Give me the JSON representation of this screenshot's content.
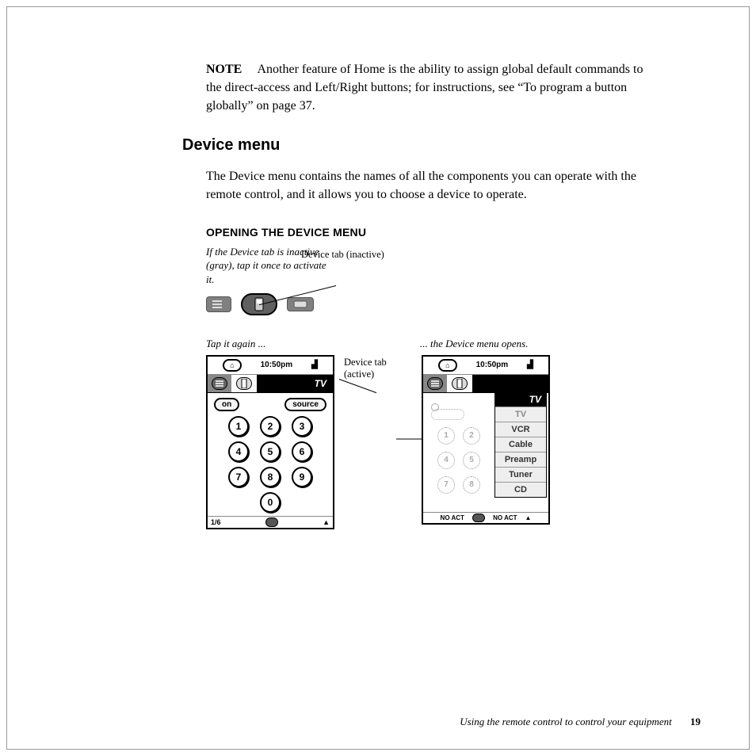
{
  "note": {
    "label": "NOTE",
    "text": "Another feature of Home is the ability to assign global default commands to the direct-access and Left/Right buttons; for instructions, see “To program a button globally” on page 37."
  },
  "section_heading": "Device menu",
  "section_body": "The Device menu contains the names of all the components you can operate with the remote control, and it allows you to choose a device to operate.",
  "subheading": "OPENING THE DEVICE MENU",
  "caption_inactive": "If the Device tab is inactive (gray), tap it once to activate it.",
  "callout_inactive": "Device tab (inactive)",
  "caption_tap_again": "Tap it again ...",
  "caption_opens": "... the Device menu opens.",
  "callout_active": "Device tab (active)",
  "remote": {
    "time": "10:50pm",
    "current_device": "TV",
    "on_label": "on",
    "source_label": "source",
    "page_indicator": "1/6",
    "digits": [
      "1",
      "2",
      "3",
      "4",
      "5",
      "6",
      "7",
      "8",
      "9",
      "0"
    ]
  },
  "menu": {
    "header": "TV",
    "items": [
      "TV",
      "VCR",
      "Cable",
      "Preamp",
      "Tuner",
      "CD"
    ]
  },
  "noact": "NO ACT",
  "footer": {
    "text": "Using the remote control to control your equipment",
    "page": "19"
  }
}
